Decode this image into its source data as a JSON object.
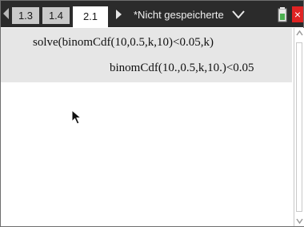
{
  "tabs": [
    {
      "label": "1.3",
      "active": false
    },
    {
      "label": "1.4",
      "active": false
    },
    {
      "label": "2.1",
      "active": true
    }
  ],
  "document": {
    "title": "*Nicht gespeicherte"
  },
  "calculator": {
    "input": "solve(binomCdf(10,0.5,k,10)<0.05,k)",
    "output": "binomCdf(10.,0.5,k,10.)<0.05"
  },
  "colors": {
    "tabbar_bg": "#2b2b2b",
    "active_tab_bg": "#ffffff",
    "inactive_tab_bg": "#c9c9c9",
    "entry_bg": "#e6e6e6",
    "close_button": "#e02323",
    "battery_green": "#4caf50"
  },
  "icons": {
    "nav_left": "triangle-left-icon",
    "nav_right": "triangle-right-icon",
    "dropdown": "chevron-down-icon",
    "battery": "battery-icon",
    "close": "close-icon",
    "scroll_up": "scroll-up-icon",
    "scroll_down": "scroll-down-icon",
    "cursor": "mouse-pointer-icon"
  }
}
